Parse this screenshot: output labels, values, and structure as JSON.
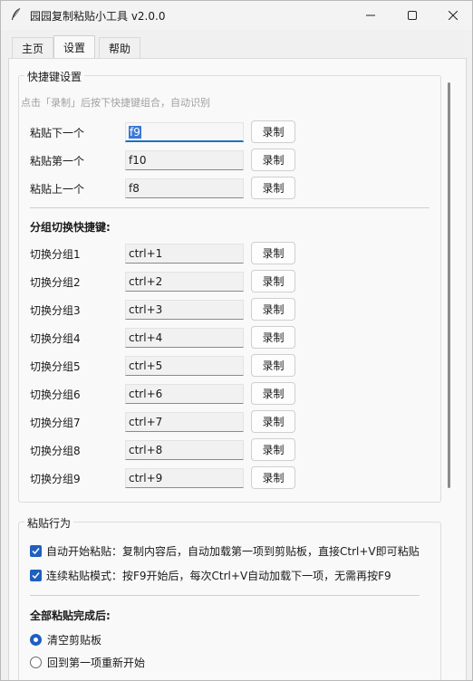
{
  "window": {
    "title": "园园复制粘贴小工具 v2.0.0",
    "app_icon": "quill-icon"
  },
  "tabs": [
    {
      "label": "主页"
    },
    {
      "label": "设置"
    },
    {
      "label": "帮助"
    }
  ],
  "active_tab": "设置",
  "hotkeys": {
    "group_label": "快捷键设置",
    "hint": "点击「录制」后按下快捷键组合，自动识别",
    "record_label": "录制",
    "rows": [
      {
        "label": "粘贴下一个",
        "value": "f9"
      },
      {
        "label": "粘贴第一个",
        "value": "f10"
      },
      {
        "label": "粘贴上一个",
        "value": "f8"
      }
    ],
    "group_switch_title": "分组切换快捷键:",
    "group_rows": [
      {
        "label": "切换分组1",
        "value": "ctrl+1"
      },
      {
        "label": "切换分组2",
        "value": "ctrl+2"
      },
      {
        "label": "切换分组3",
        "value": "ctrl+3"
      },
      {
        "label": "切换分组4",
        "value": "ctrl+4"
      },
      {
        "label": "切换分组5",
        "value": "ctrl+5"
      },
      {
        "label": "切换分组6",
        "value": "ctrl+6"
      },
      {
        "label": "切换分组7",
        "value": "ctrl+7"
      },
      {
        "label": "切换分组8",
        "value": "ctrl+8"
      },
      {
        "label": "切换分组9",
        "value": "ctrl+9"
      }
    ]
  },
  "paste_behavior": {
    "group_label": "粘贴行为",
    "options": [
      {
        "label": "自动开始粘贴：复制内容后，自动加载第一项到剪贴板，直接Ctrl+V即可粘贴",
        "checked": true
      },
      {
        "label": "连续粘贴模式：按F9开始后，每次Ctrl+V自动加载下一项，无需再按F9",
        "checked": true
      }
    ],
    "after_title": "全部粘贴完成后:",
    "after_options": [
      {
        "label": "清空剪贴板",
        "selected": true
      },
      {
        "label": "回到第一项重新开始",
        "selected": false
      }
    ]
  },
  "colors": {
    "accent": "#1f5fbf",
    "hint_text": "#a0a0a0"
  }
}
